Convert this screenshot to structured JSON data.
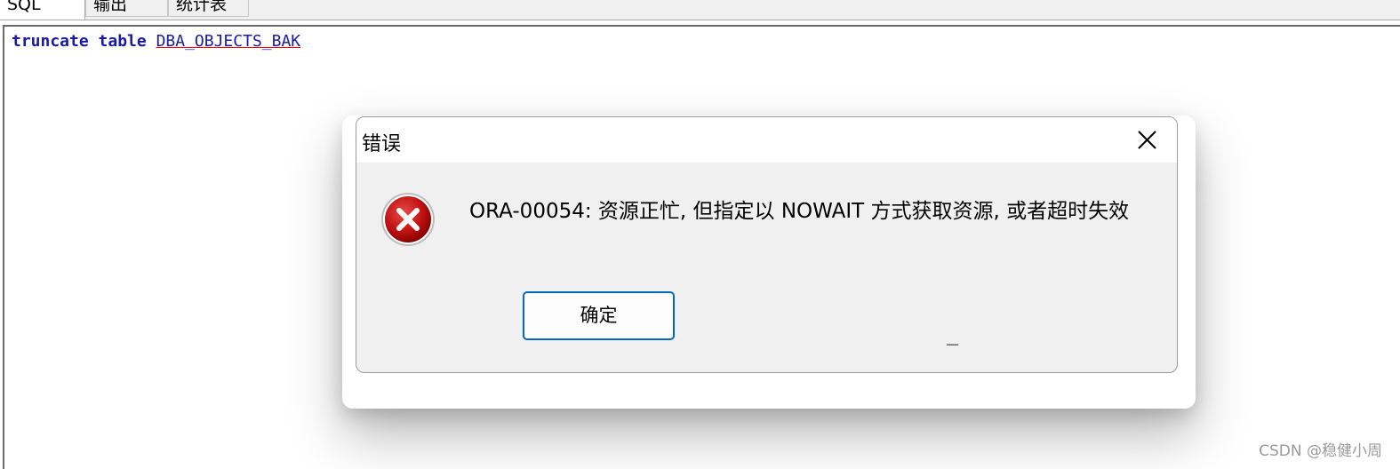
{
  "tabs": [
    {
      "label": "SQL"
    },
    {
      "label": "输出"
    },
    {
      "label": "统计表"
    }
  ],
  "editor": {
    "kw1": "truncate",
    "kw2": "table",
    "identifier": "DBA_OBJECTS_BAK"
  },
  "dialog": {
    "title": "错误",
    "icon": "error-icon",
    "message": "ORA-00054: 资源正忙, 但指定以 NOWAIT 方式获取资源, 或者超时失效",
    "ok_label": "确定",
    "cursor_text": "_"
  },
  "watermark": "CSDN @稳健小周",
  "colors": {
    "keyword": "#1a1aa6",
    "error_red": "#c00000",
    "button_border": "#0067c0"
  }
}
